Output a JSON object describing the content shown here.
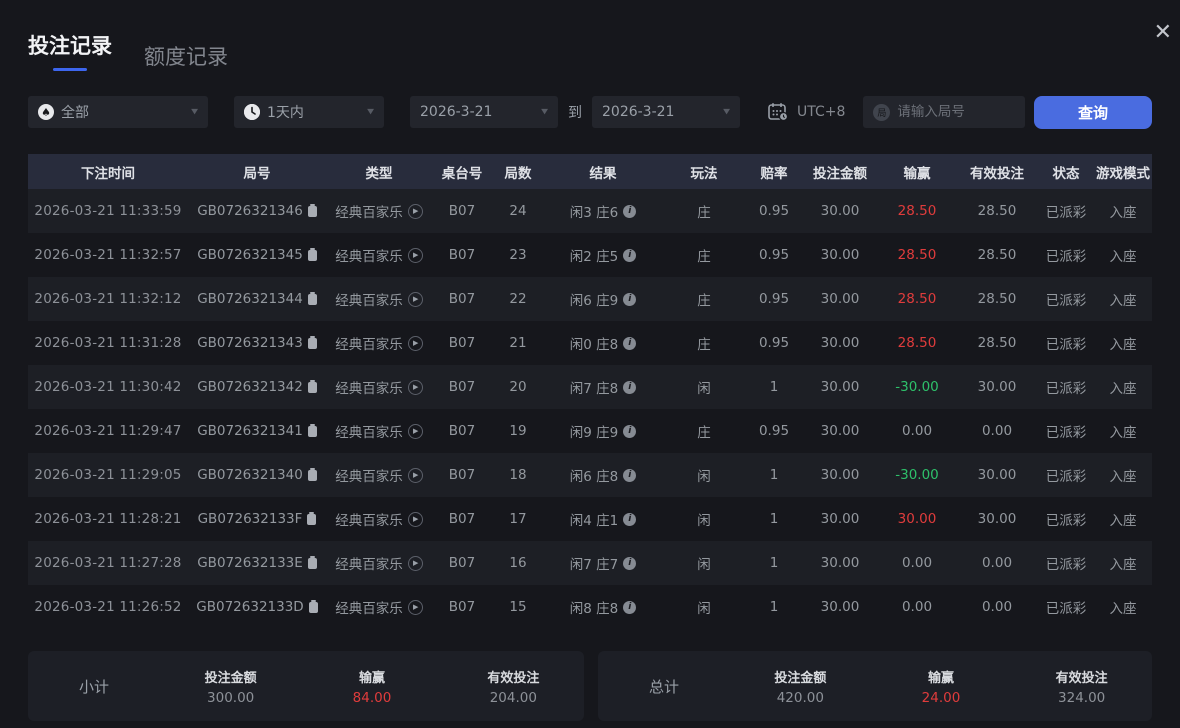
{
  "palette": {
    "accent_blue": "#4a6ce0",
    "tab_underline": "#3d66ee",
    "red": "#e03c3c",
    "green": "#2ec06a"
  },
  "icons": {
    "spade": "♠",
    "chevron": "▼",
    "play": "▶",
    "info": "i",
    "close": "✕",
    "search_circle_char": "局"
  },
  "tabs": [
    {
      "label": "投注记录",
      "active": true
    },
    {
      "label": "额度记录",
      "active": false
    }
  ],
  "filters": {
    "category": {
      "value": "全部"
    },
    "time_range": {
      "value": "1天内"
    },
    "date_from": "2026-3-21",
    "to_label": "到",
    "date_to": "2026-3-21",
    "timezone": "UTC+8",
    "search": {
      "placeholder": "请输入局号"
    },
    "query_button": "查询"
  },
  "table": {
    "columns": [
      {
        "key": "time",
        "label": "下注时间"
      },
      {
        "key": "game_id",
        "label": "局号"
      },
      {
        "key": "type",
        "label": "类型"
      },
      {
        "key": "table_no",
        "label": "桌台号"
      },
      {
        "key": "round",
        "label": "局数"
      },
      {
        "key": "result",
        "label": "结果"
      },
      {
        "key": "play",
        "label": "玩法"
      },
      {
        "key": "odds",
        "label": "赔率"
      },
      {
        "key": "bet_amount",
        "label": "投注金额"
      },
      {
        "key": "win_loss",
        "label": "输赢"
      },
      {
        "key": "valid_bet",
        "label": "有效投注"
      },
      {
        "key": "status",
        "label": "状态"
      },
      {
        "key": "mode",
        "label": "游戏模式"
      }
    ],
    "rows": [
      {
        "time": "2026-03-21 11:33:59",
        "game_id": "GB0726321346",
        "type": "经典百家乐",
        "table_no": "B07",
        "round": "24",
        "result": "闲3 庄6",
        "play": "庄",
        "odds": "0.95",
        "bet_amount": "30.00",
        "win_loss": "28.50",
        "win_state": "red",
        "valid_bet": "28.50",
        "status": "已派彩",
        "mode": "入座"
      },
      {
        "time": "2026-03-21 11:32:57",
        "game_id": "GB0726321345",
        "type": "经典百家乐",
        "table_no": "B07",
        "round": "23",
        "result": "闲2 庄5",
        "play": "庄",
        "odds": "0.95",
        "bet_amount": "30.00",
        "win_loss": "28.50",
        "win_state": "red",
        "valid_bet": "28.50",
        "status": "已派彩",
        "mode": "入座"
      },
      {
        "time": "2026-03-21 11:32:12",
        "game_id": "GB0726321344",
        "type": "经典百家乐",
        "table_no": "B07",
        "round": "22",
        "result": "闲6 庄9",
        "play": "庄",
        "odds": "0.95",
        "bet_amount": "30.00",
        "win_loss": "28.50",
        "win_state": "red",
        "valid_bet": "28.50",
        "status": "已派彩",
        "mode": "入座"
      },
      {
        "time": "2026-03-21 11:31:28",
        "game_id": "GB0726321343",
        "type": "经典百家乐",
        "table_no": "B07",
        "round": "21",
        "result": "闲0 庄8",
        "play": "庄",
        "odds": "0.95",
        "bet_amount": "30.00",
        "win_loss": "28.50",
        "win_state": "red",
        "valid_bet": "28.50",
        "status": "已派彩",
        "mode": "入座"
      },
      {
        "time": "2026-03-21 11:30:42",
        "game_id": "GB0726321342",
        "type": "经典百家乐",
        "table_no": "B07",
        "round": "20",
        "result": "闲7 庄8",
        "play": "闲",
        "odds": "1",
        "bet_amount": "30.00",
        "win_loss": "-30.00",
        "win_state": "green",
        "valid_bet": "30.00",
        "status": "已派彩",
        "mode": "入座"
      },
      {
        "time": "2026-03-21 11:29:47",
        "game_id": "GB0726321341",
        "type": "经典百家乐",
        "table_no": "B07",
        "round": "19",
        "result": "闲9 庄9",
        "play": "庄",
        "odds": "0.95",
        "bet_amount": "30.00",
        "win_loss": "0.00",
        "win_state": "plain",
        "valid_bet": "0.00",
        "status": "已派彩",
        "mode": "入座"
      },
      {
        "time": "2026-03-21 11:29:05",
        "game_id": "GB0726321340",
        "type": "经典百家乐",
        "table_no": "B07",
        "round": "18",
        "result": "闲6 庄8",
        "play": "闲",
        "odds": "1",
        "bet_amount": "30.00",
        "win_loss": "-30.00",
        "win_state": "green",
        "valid_bet": "30.00",
        "status": "已派彩",
        "mode": "入座"
      },
      {
        "time": "2026-03-21 11:28:21",
        "game_id": "GB072632133F",
        "type": "经典百家乐",
        "table_no": "B07",
        "round": "17",
        "result": "闲4 庄1",
        "play": "闲",
        "odds": "1",
        "bet_amount": "30.00",
        "win_loss": "30.00",
        "win_state": "red",
        "valid_bet": "30.00",
        "status": "已派彩",
        "mode": "入座"
      },
      {
        "time": "2026-03-21 11:27:28",
        "game_id": "GB072632133E",
        "type": "经典百家乐",
        "table_no": "B07",
        "round": "16",
        "result": "闲7 庄7",
        "play": "闲",
        "odds": "1",
        "bet_amount": "30.00",
        "win_loss": "0.00",
        "win_state": "plain",
        "valid_bet": "0.00",
        "status": "已派彩",
        "mode": "入座"
      },
      {
        "time": "2026-03-21 11:26:52",
        "game_id": "GB072632133D",
        "type": "经典百家乐",
        "table_no": "B07",
        "round": "15",
        "result": "闲8 庄8",
        "play": "闲",
        "odds": "1",
        "bet_amount": "30.00",
        "win_loss": "0.00",
        "win_state": "plain",
        "valid_bet": "0.00",
        "status": "已派彩",
        "mode": "入座"
      }
    ]
  },
  "summary": [
    {
      "title": "小计",
      "items": [
        {
          "label": "投注金额",
          "value": "300.00",
          "state": "plain"
        },
        {
          "label": "输赢",
          "value": "84.00",
          "state": "red"
        },
        {
          "label": "有效投注",
          "value": "204.00",
          "state": "plain"
        }
      ]
    },
    {
      "title": "总计",
      "items": [
        {
          "label": "投注金额",
          "value": "420.00",
          "state": "plain"
        },
        {
          "label": "输赢",
          "value": "24.00",
          "state": "red"
        },
        {
          "label": "有效投注",
          "value": "324.00",
          "state": "plain"
        }
      ]
    }
  ]
}
